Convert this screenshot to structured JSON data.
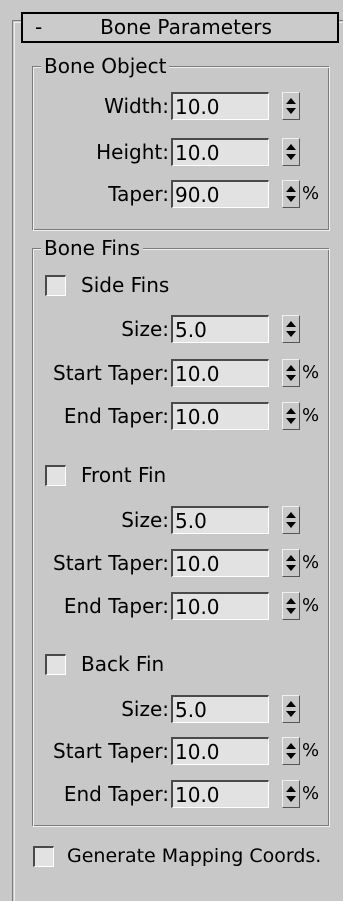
{
  "rollout": {
    "collapse_symbol": "-",
    "title": "Bone Parameters"
  },
  "bone_object": {
    "group_label": "Bone Object",
    "width": {
      "label": "Width:",
      "value": "10.0"
    },
    "height": {
      "label": "Height:",
      "value": "10.0"
    },
    "taper": {
      "label": "Taper:",
      "value": "90.0",
      "unit": "%"
    }
  },
  "bone_fins": {
    "group_label": "Bone Fins",
    "side_fins": {
      "label": "Side Fins",
      "checked": false,
      "size": {
        "label": "Size:",
        "value": "5.0"
      },
      "start_taper": {
        "label": "Start Taper:",
        "value": "10.0",
        "unit": "%"
      },
      "end_taper": {
        "label": "End Taper:",
        "value": "10.0",
        "unit": "%"
      }
    },
    "front_fin": {
      "label": "Front Fin",
      "checked": false,
      "size": {
        "label": "Size:",
        "value": "5.0"
      },
      "start_taper": {
        "label": "Start Taper:",
        "value": "10.0",
        "unit": "%"
      },
      "end_taper": {
        "label": "End Taper:",
        "value": "10.0",
        "unit": "%"
      }
    },
    "back_fin": {
      "label": "Back Fin",
      "checked": false,
      "size": {
        "label": "Size:",
        "value": "5.0"
      },
      "start_taper": {
        "label": "Start Taper:",
        "value": "10.0",
        "unit": "%"
      },
      "end_taper": {
        "label": "End Taper:",
        "value": "10.0",
        "unit": "%"
      }
    }
  },
  "generate_mapping": {
    "label": "Generate Mapping Coords.",
    "checked": false
  }
}
